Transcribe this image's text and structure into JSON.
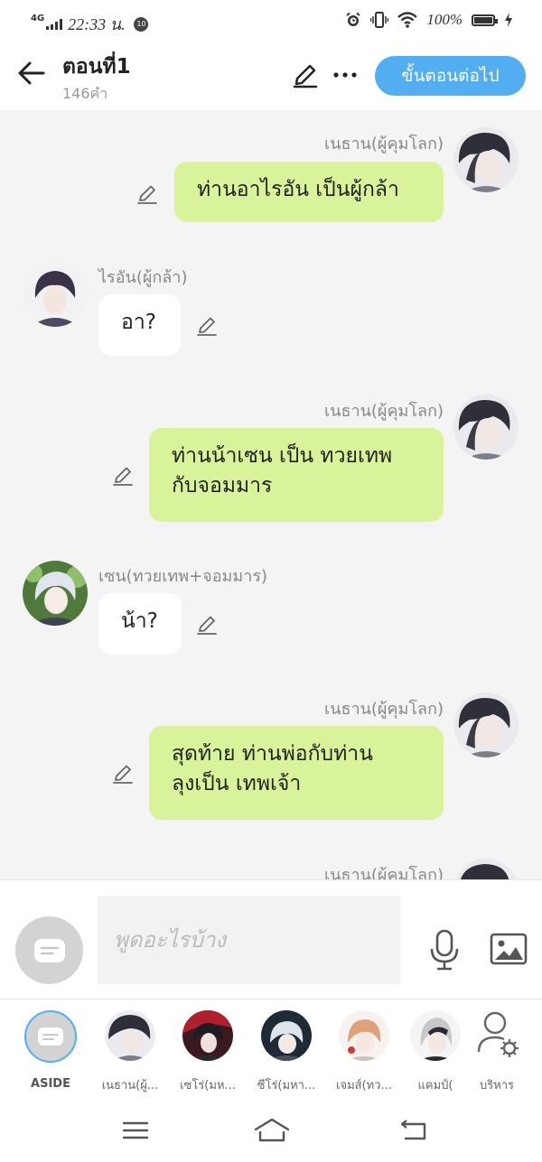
{
  "status_bar": {
    "network": "4G",
    "time": "22:33 น.",
    "notification_count": "10",
    "battery": "100%"
  },
  "header": {
    "title": "ตอนที่1",
    "word_count": "146คำ",
    "next_label": "ขั้นตอนต่อไป"
  },
  "messages": [
    {
      "side": "right",
      "speaker": "เนธาน(ผู้คุมโลก)",
      "text": "ท่านอาไรอัน เป็นผู้กล้า"
    },
    {
      "side": "left",
      "speaker": "ไรอัน(ผู้กล้า)",
      "text": "อา?"
    },
    {
      "side": "right",
      "speaker": "เนธาน(ผู้คุมโลก)",
      "text": "ท่านน้าเซน เป็น ทวยเทพ\nกับจอมมาร"
    },
    {
      "side": "left",
      "speaker": "เซน(ทวยเทพ+จอมมาร)",
      "text": "น้า?"
    },
    {
      "side": "right",
      "speaker": "เนธาน(ผู้คุมโลก)",
      "text": "สุดท้าย ท่านพ่อกับท่าน\nลุงเป็น เทพเจ้า"
    },
    {
      "side": "right",
      "speaker": "เนธาน(ผู้คุมโลก)",
      "text": ""
    }
  ],
  "composer": {
    "placeholder": "พูดอะไรบ้าง"
  },
  "characters": [
    {
      "label": "ASIDE"
    },
    {
      "label": "เนธาน(ผู้..."
    },
    {
      "label": "เซโร่(มห..."
    },
    {
      "label": "ซีโร่(มหา..."
    },
    {
      "label": "เจมส์(ทว..."
    },
    {
      "label": "แคมป์("
    },
    {
      "label": "บริหาร"
    }
  ],
  "colors": {
    "accent": "#52aef0",
    "bubble_right": "#d8f39a",
    "bubble_left": "#ffffff",
    "chat_bg": "#f4f4f4",
    "aside_ring": "#52aef0"
  }
}
